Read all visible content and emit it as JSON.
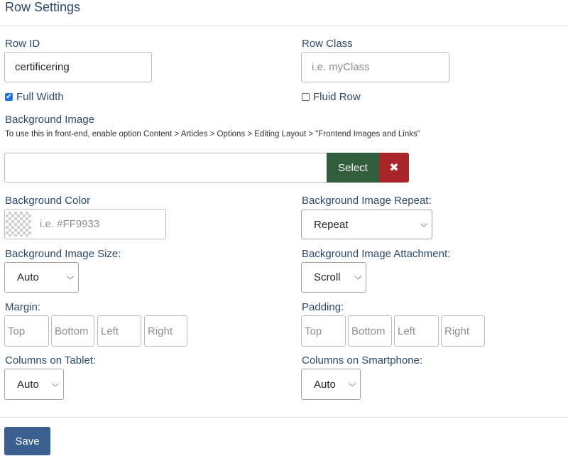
{
  "header": {
    "title": "Row Settings"
  },
  "row_id": {
    "label": "Row ID",
    "value": "certificering"
  },
  "row_class": {
    "label": "Row Class",
    "placeholder": "i.e. myClass"
  },
  "full_width": {
    "label": "Full Width",
    "checked": true
  },
  "fluid_row": {
    "label": "Fluid Row",
    "checked": false
  },
  "background_image": {
    "label": "Background Image",
    "hint": "To use this in front-end, enable option Content > Articles > Options > Editing Layout > \"Frontend Images and Links\"",
    "value": "",
    "select_label": "Select",
    "clear_icon": "✖"
  },
  "background_color": {
    "label": "Background Color",
    "placeholder": "i.e. #FF9933"
  },
  "background_image_repeat": {
    "label": "Background Image Repeat:",
    "value": "Repeat"
  },
  "background_image_size": {
    "label": "Background Image Size:",
    "value": "Auto"
  },
  "background_image_attachment": {
    "label": "Background Image Attachment:",
    "value": "Scroll"
  },
  "margin": {
    "label": "Margin:",
    "fields": [
      "Top",
      "Bottom",
      "Left",
      "Right"
    ]
  },
  "padding": {
    "label": "Padding:",
    "fields": [
      "Top",
      "Bottom",
      "Left",
      "Right"
    ]
  },
  "columns_tablet": {
    "label": "Columns on Tablet:",
    "value": "Auto"
  },
  "columns_smartphone": {
    "label": "Columns on Smartphone:",
    "value": "Auto"
  },
  "footer": {
    "save_label": "Save"
  },
  "colors": {
    "accent": "#3b5f8e",
    "select_button": "#315f3d",
    "clear_button": "#a8262a",
    "label": "#2b4a6f"
  }
}
